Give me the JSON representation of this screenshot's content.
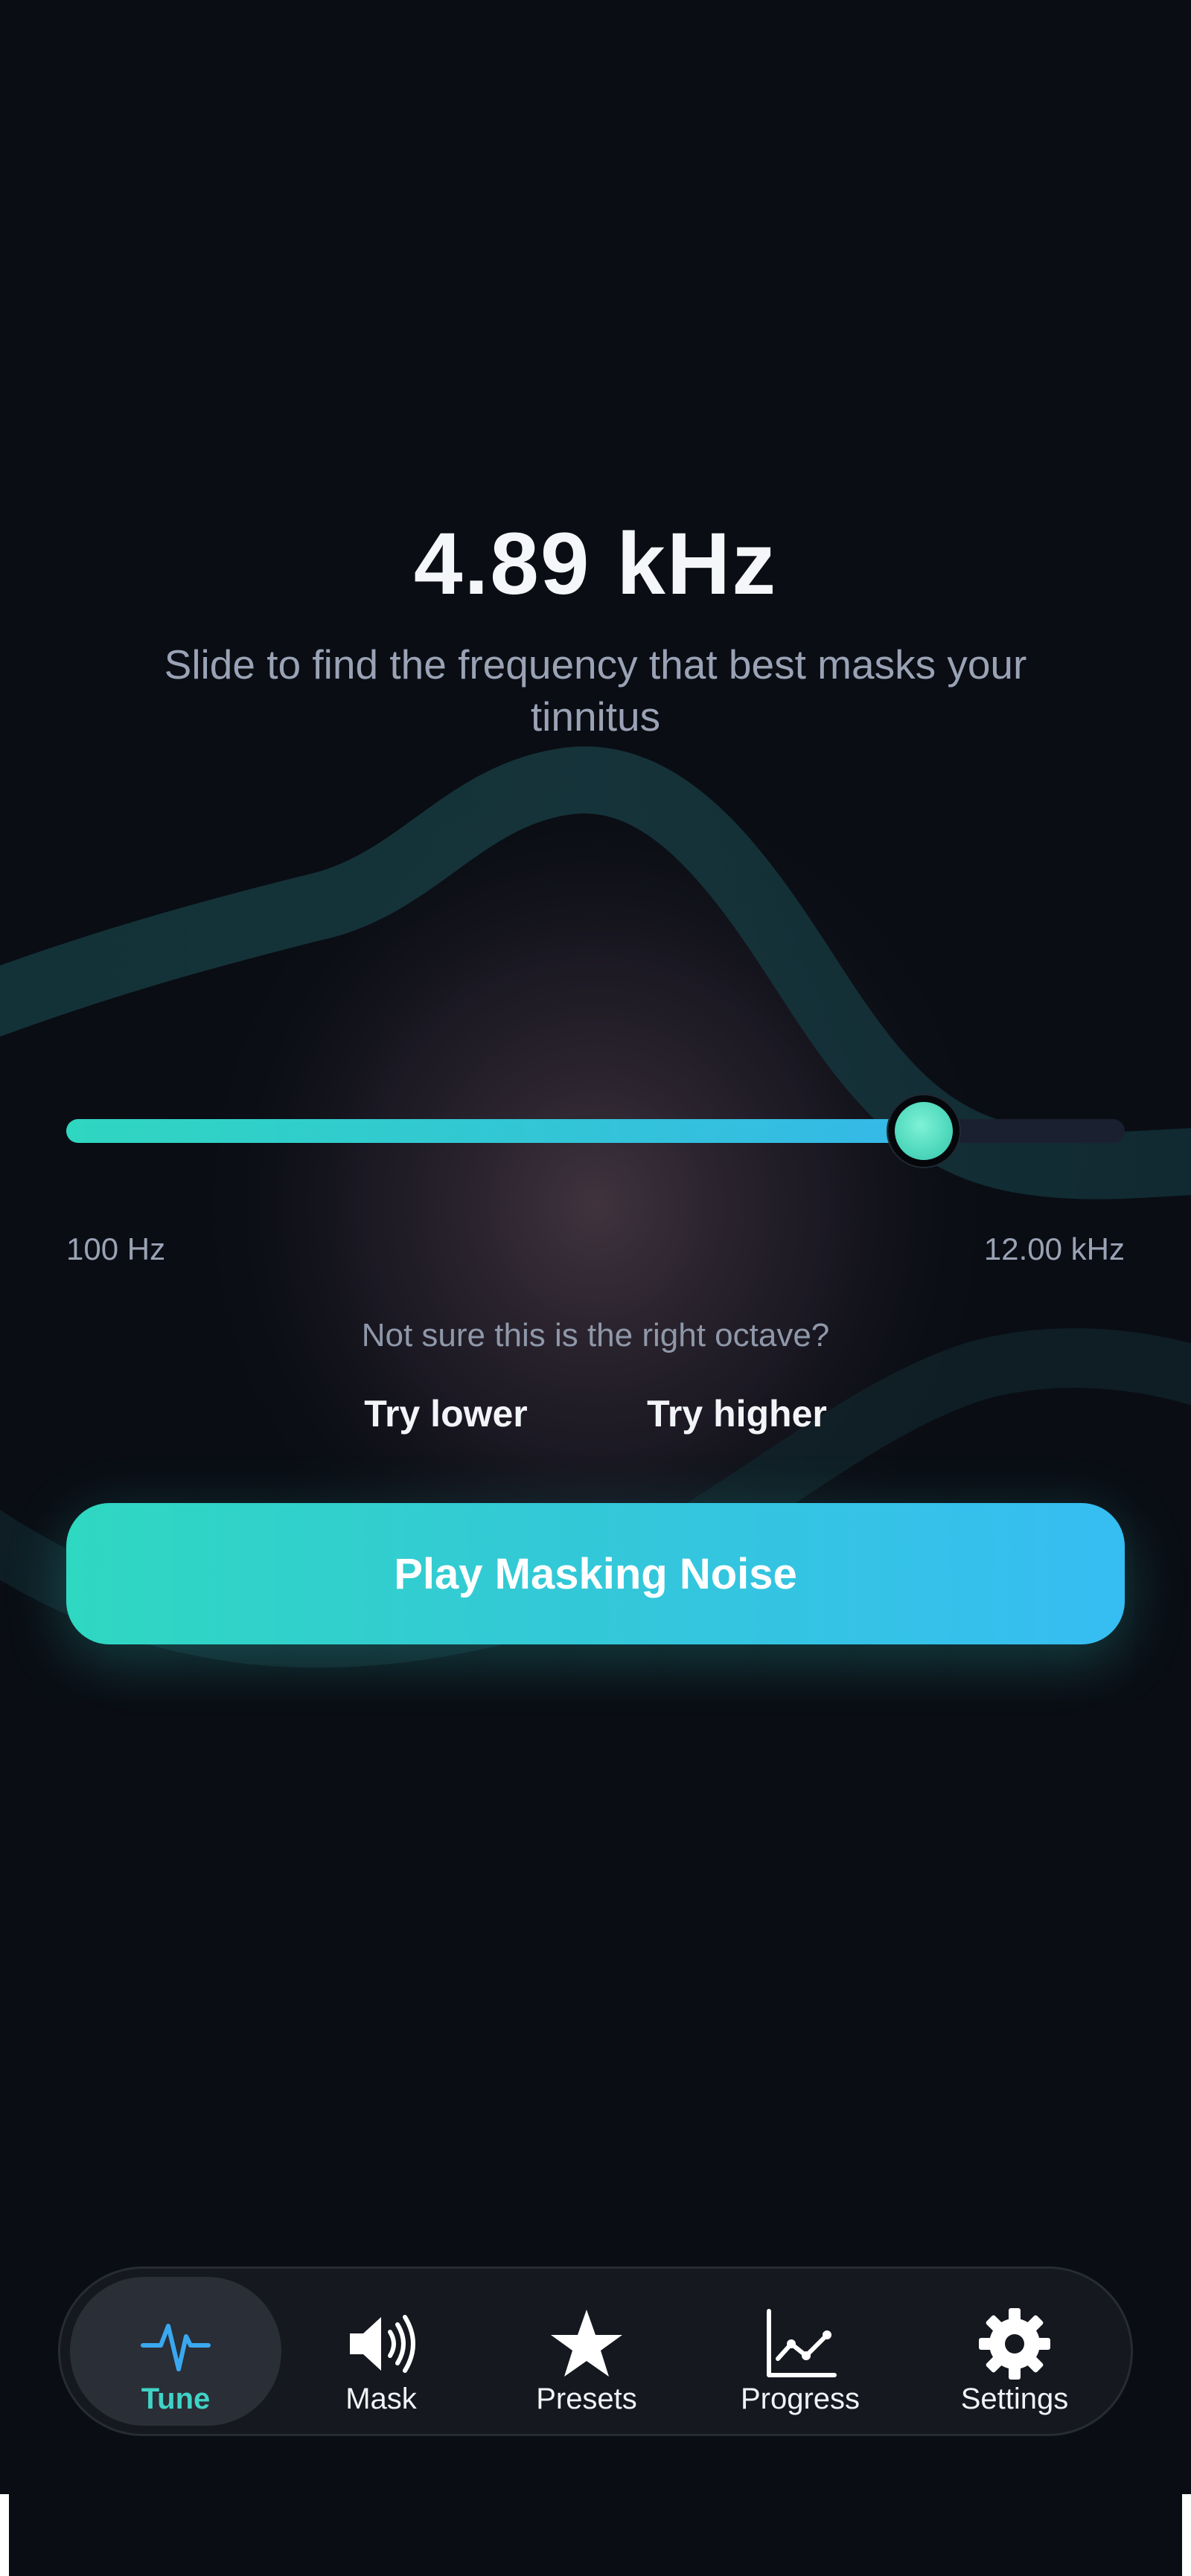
{
  "tuner": {
    "frequency": "4.89 kHz",
    "instruction": "Slide to find the frequency that best masks your tinnitus",
    "slider": {
      "min_label": "100 Hz",
      "max_label": "12.00 kHz",
      "fraction": 0.81
    },
    "octave_question": "Not sure this is the right octave?",
    "try_lower_label": "Try lower",
    "try_higher_label": "Try higher",
    "play_label": "Play Masking Noise"
  },
  "tabs": [
    {
      "label": "Tune",
      "icon": "heartbeat-icon",
      "active": true
    },
    {
      "label": "Mask",
      "icon": "speaker-icon",
      "active": false
    },
    {
      "label": "Presets",
      "icon": "star-icon",
      "active": false
    },
    {
      "label": "Progress",
      "icon": "chart-icon",
      "active": false
    },
    {
      "label": "Settings",
      "icon": "gear-icon",
      "active": false
    }
  ],
  "colors": {
    "background": "#0a0d14",
    "accent_teal": "#2fd6c0",
    "accent_blue": "#36bdf3",
    "muted_text": "#9aa3b5"
  }
}
